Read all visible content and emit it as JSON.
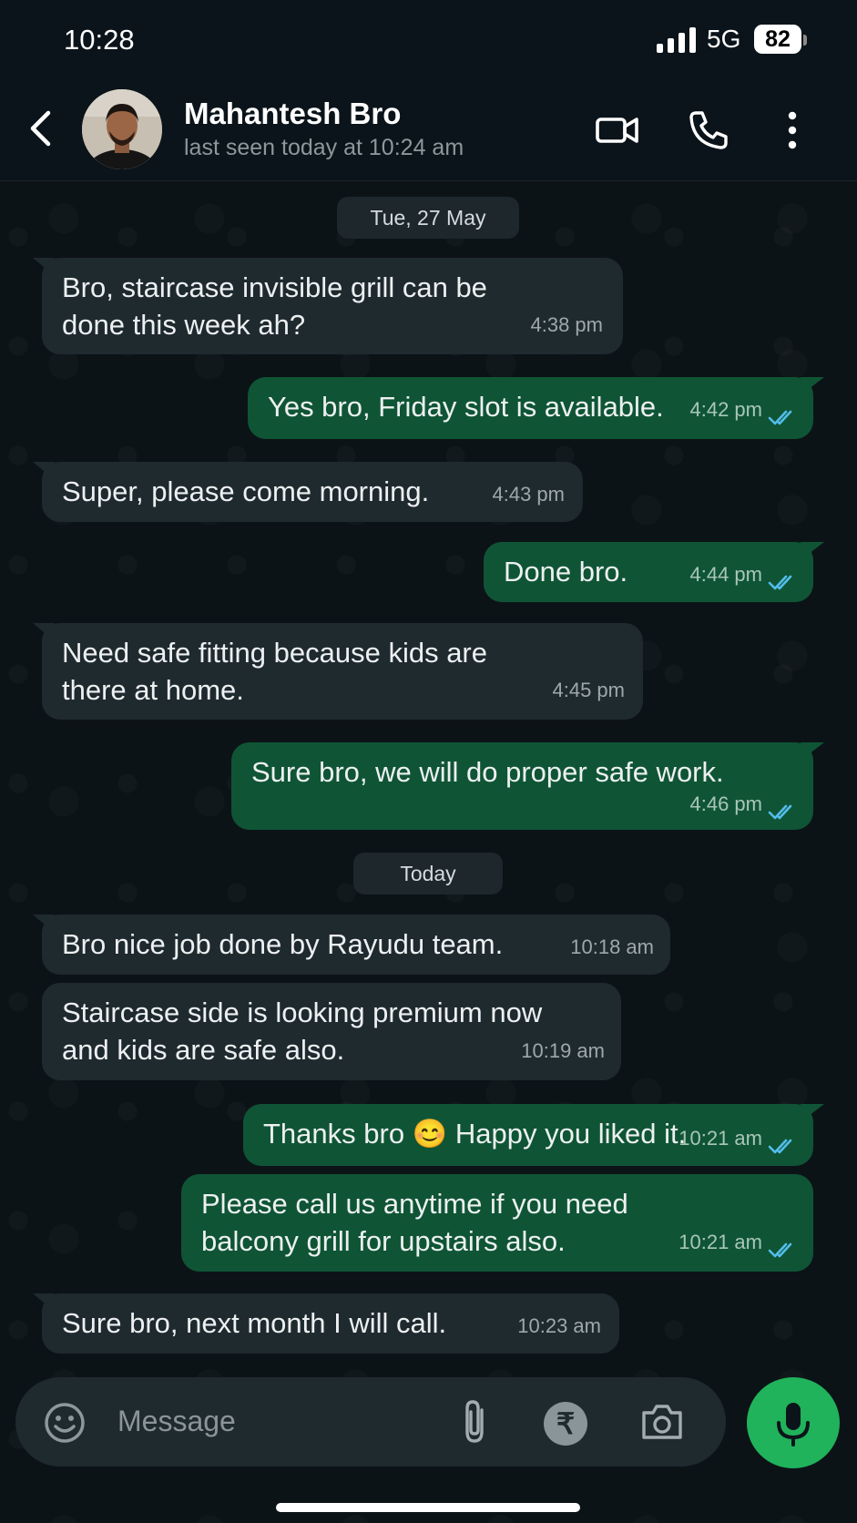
{
  "status_bar": {
    "time": "10:28",
    "network": "5G",
    "battery": "82"
  },
  "header": {
    "contact_name": "Mahantesh Bro",
    "last_seen": "last seen today at 10:24 am",
    "icons": [
      "back-arrow-icon",
      "video-call-icon",
      "voice-call-icon",
      "more-options-icon"
    ]
  },
  "date_chips": {
    "first": "Tue, 27 May",
    "second": "Today"
  },
  "messages": [
    {
      "dir": "in",
      "text": [
        "Bro, staircase invisible grill can be",
        "done this week ah?"
      ],
      "time": "4:38 pm"
    },
    {
      "dir": "out",
      "text": [
        "Yes bro, Friday slot is available."
      ],
      "time": "4:42 pm",
      "status": "read"
    },
    {
      "dir": "in",
      "text": [
        "Super, please come morning."
      ],
      "time": "4:43 pm"
    },
    {
      "dir": "out",
      "text": [
        "Done bro."
      ],
      "time": "4:44 pm",
      "status": "read"
    },
    {
      "dir": "in",
      "text": [
        "Need safe fitting because kids are",
        "there at home."
      ],
      "time": "4:45 pm"
    },
    {
      "dir": "out",
      "text": [
        "Sure bro, we will do proper safe work."
      ],
      "time": "4:46 pm",
      "status": "read"
    },
    {
      "dir": "in",
      "text": [
        "Bro nice job done by Rayudu team."
      ],
      "time": "10:18 am"
    },
    {
      "dir": "in",
      "text": [
        "Staircase side is looking premium now",
        "and kids are safe also."
      ],
      "time": "10:19 am"
    },
    {
      "dir": "out",
      "text": [
        "Thanks bro 😊 Happy you liked it."
      ],
      "time": "10:21 am",
      "status": "read"
    },
    {
      "dir": "out",
      "text": [
        "Please call us anytime if you need",
        "balcony grill for upstairs also."
      ],
      "time": "10:21 am",
      "status": "read"
    },
    {
      "dir": "in",
      "text": [
        "Sure bro, next month I will call."
      ],
      "time": "10:23 am"
    }
  ],
  "composer": {
    "placeholder": "Message",
    "rupee_symbol": "₹",
    "icons": [
      "emoji-icon",
      "attach-icon",
      "payment-icon",
      "camera-icon",
      "microphone-icon"
    ]
  },
  "colors": {
    "incoming": "#1f2a2f",
    "outgoing": "#0f5535",
    "read_ticks": "#53bdeb",
    "mic_button": "#20b35b"
  }
}
